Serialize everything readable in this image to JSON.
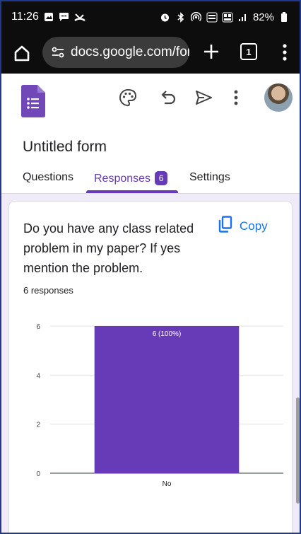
{
  "status_bar": {
    "time": "11:26",
    "battery": "82%"
  },
  "browser": {
    "url": "docs.google.com/for",
    "tab_count": "1"
  },
  "form": {
    "title": "Untitled form",
    "tabs": [
      {
        "label": "Questions"
      },
      {
        "label": "Responses",
        "badge": "6"
      },
      {
        "label": "Settings"
      }
    ]
  },
  "card": {
    "question": "Do you have any class related problem in my paper? If yes mention the problem.",
    "copy_label": "Copy",
    "responses": "6 responses"
  },
  "colors": {
    "accent": "#673ab7",
    "bar": "#673ab7",
    "link": "#1a73e8"
  },
  "chart_data": {
    "type": "bar",
    "categories": [
      "No"
    ],
    "values": [
      6
    ],
    "data_labels": [
      "6 (100%)"
    ],
    "ylim": [
      0,
      6
    ],
    "yticks": [
      0,
      2,
      4,
      6
    ],
    "grid": true
  }
}
